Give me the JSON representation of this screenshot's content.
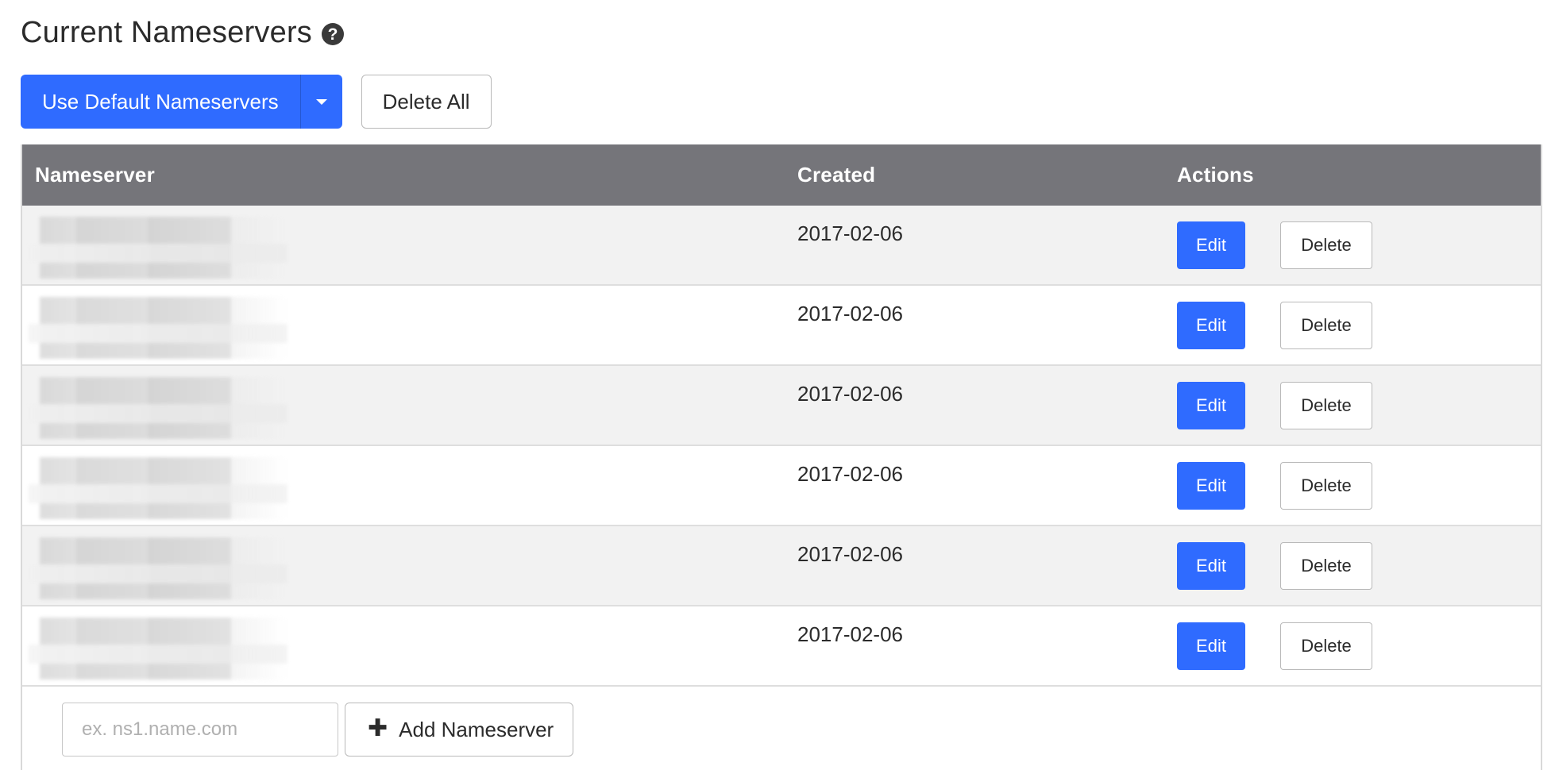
{
  "header": {
    "title": "Current Nameservers",
    "help_icon": "question-circle-icon"
  },
  "toolbar": {
    "use_default_label": "Use Default Nameservers",
    "delete_all_label": "Delete All"
  },
  "table": {
    "columns": [
      "Nameserver",
      "Created",
      "Actions"
    ],
    "rows": [
      {
        "nameserver": "",
        "created": "2017-02-06",
        "edit_label": "Edit",
        "delete_label": "Delete"
      },
      {
        "nameserver": "",
        "created": "2017-02-06",
        "edit_label": "Edit",
        "delete_label": "Delete"
      },
      {
        "nameserver": "",
        "created": "2017-02-06",
        "edit_label": "Edit",
        "delete_label": "Delete"
      },
      {
        "nameserver": "",
        "created": "2017-02-06",
        "edit_label": "Edit",
        "delete_label": "Delete"
      },
      {
        "nameserver": "",
        "created": "2017-02-06",
        "edit_label": "Edit",
        "delete_label": "Delete"
      },
      {
        "nameserver": "",
        "created": "2017-02-06",
        "edit_label": "Edit",
        "delete_label": "Delete"
      }
    ]
  },
  "add_form": {
    "input_value": "",
    "input_placeholder": "ex. ns1.name.com",
    "add_button_label": "Add Nameserver",
    "add_icon": "plus-icon"
  },
  "colors": {
    "primary": "#2f6bff",
    "table_header_bg": "#75757a",
    "row_stripe": "#f2f2f2"
  }
}
